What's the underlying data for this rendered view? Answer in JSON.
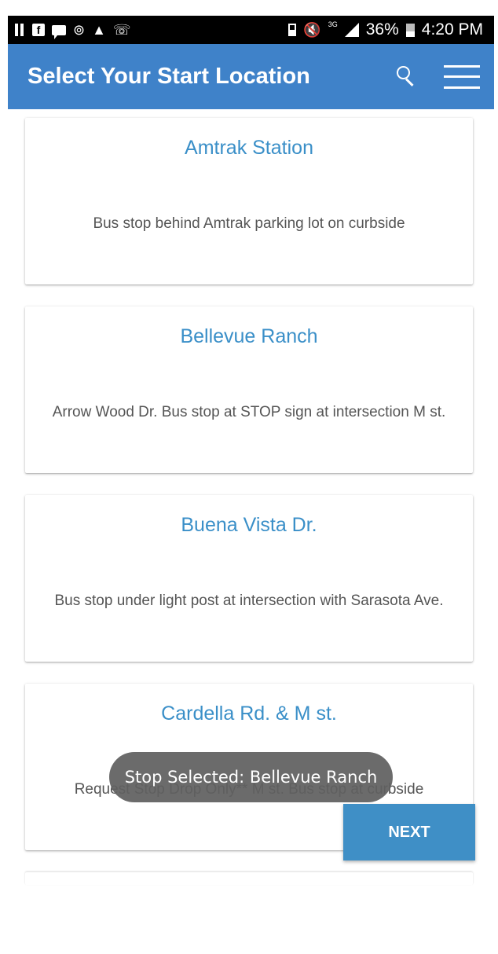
{
  "status_bar": {
    "battery_percent": "36%",
    "time": "4:20 PM",
    "network_type": "3G",
    "left_icons": [
      "pause-icon",
      "facebook-icon",
      "chat-icon",
      "people-icon",
      "warning-icon",
      "viber-icon"
    ],
    "right_icons": [
      "battery-saver-icon",
      "mute-icon",
      "signal-icon",
      "battery-icon"
    ]
  },
  "app_bar": {
    "title": "Select Your Start Location",
    "color": "#3f82c9"
  },
  "stops": [
    {
      "name": "Amtrak Station",
      "description": "Bus stop behind Amtrak parking lot on curbside"
    },
    {
      "name": "Bellevue Ranch",
      "description": "Arrow Wood Dr. Bus stop at STOP sign at intersection M st."
    },
    {
      "name": "Buena Vista Dr.",
      "description": "Bus stop under light post at intersection with Sarasota Ave."
    },
    {
      "name": "Cardella Rd. & M st.",
      "description": "Request Stop Drop Only** M st. Bus stop at curbside"
    }
  ],
  "toast": {
    "text": "Stop Selected: Bellevue Ranch"
  },
  "next_button": {
    "label": "NEXT"
  },
  "colors": {
    "accent": "#3a8fc8",
    "toast_bg": "#606060"
  }
}
